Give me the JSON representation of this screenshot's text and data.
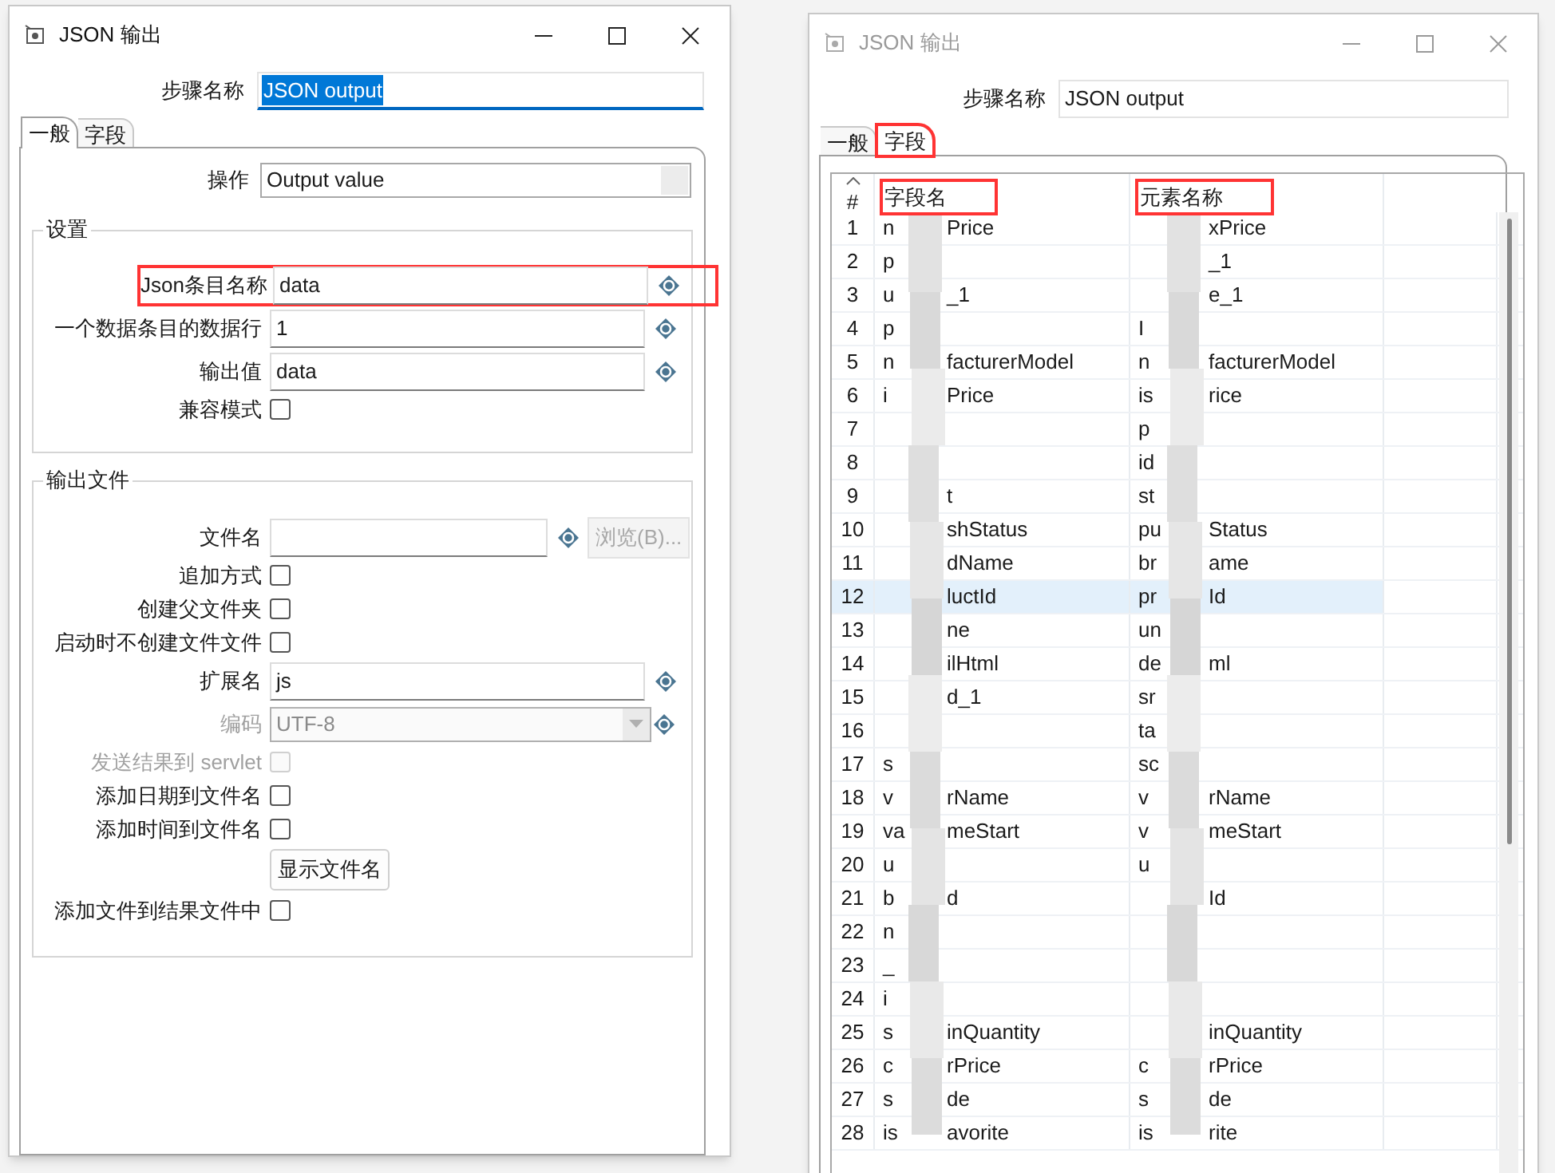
{
  "general_dialog": {
    "title": "JSON 输出",
    "active": true,
    "step_name": {
      "label": "步骤名称",
      "value": "JSON output",
      "text_selected": true
    },
    "tabs": [
      {
        "label": "一般",
        "selected": true
      },
      {
        "label": "字段",
        "selected": false
      }
    ],
    "operation": {
      "label": "操作",
      "value": "Output value"
    },
    "groups": [
      {
        "title": "设置",
        "rows": [
          {
            "kind": "text",
            "label": "Json条目名称",
            "value": "data",
            "variable": true,
            "annotated": true
          },
          {
            "kind": "text",
            "label": "一个数据条目的数据行",
            "value": "1",
            "variable": true
          },
          {
            "kind": "text",
            "label": "输出值",
            "value": "data",
            "variable": true
          },
          {
            "kind": "checkbox",
            "label": "兼容模式",
            "checked": false
          }
        ]
      },
      {
        "title": "输出文件",
        "rows": [
          {
            "kind": "text",
            "label": "文件名",
            "variable": true,
            "button": {
              "label": "浏览(B)...",
              "disabled": true
            }
          },
          {
            "kind": "checkbox",
            "label": "追加方式",
            "checked": false
          },
          {
            "kind": "checkbox",
            "label": "创建父文件夹",
            "checked": false
          },
          {
            "kind": "checkbox",
            "label": "启动时不创建文件文件",
            "checked": false
          },
          {
            "kind": "text",
            "label": "扩展名",
            "value": "js",
            "variable": true
          },
          {
            "kind": "combo",
            "label": "编码",
            "value": "UTF-8",
            "disabled": true,
            "variable": true
          },
          {
            "kind": "checkbox",
            "label": "发送结果到 servlet",
            "checked": false,
            "disabled": true
          },
          {
            "kind": "checkbox",
            "label": "添加日期到文件名",
            "checked": false
          },
          {
            "kind": "checkbox",
            "label": "添加时间到文件名",
            "checked": false
          },
          {
            "kind": "button",
            "label": "显示文件名"
          },
          {
            "kind": "checkbox",
            "label": "添加文件到结果文件中",
            "checked": false
          }
        ]
      }
    ]
  },
  "fields_dialog": {
    "title": "JSON 输出",
    "active": false,
    "step_name": {
      "label": "步骤名称",
      "value": "JSON output",
      "text_selected": false
    },
    "tabs": [
      {
        "label": "一般",
        "selected": false
      },
      {
        "label": "字段",
        "selected": true,
        "annotated": true
      }
    ],
    "table": {
      "columns": [
        {
          "label": "#"
        },
        {
          "label": "字段名",
          "annotated": true
        },
        {
          "label": "元素名称",
          "annotated": true
        }
      ],
      "rows": [
        {
          "number": "1",
          "field": {
            "start": "n",
            "end": "Price"
          },
          "element": {
            "end": "xPrice"
          },
          "selected": false
        },
        {
          "number": "2",
          "field": {
            "start": "p"
          },
          "element": {
            "end": "_1"
          },
          "selected": false
        },
        {
          "number": "3",
          "field": {
            "start": "u",
            "end": "_1"
          },
          "element": {
            "end": "e_1"
          },
          "selected": false
        },
        {
          "number": "4",
          "field": {
            "start": "p"
          },
          "element": {
            "start": "I"
          },
          "selected": false
        },
        {
          "number": "5",
          "field": {
            "start": "n",
            "end": "facturerModel"
          },
          "element": {
            "start": "n",
            "end": "facturerModel"
          },
          "selected": false
        },
        {
          "number": "6",
          "field": {
            "start": "i",
            "end": "Price"
          },
          "element": {
            "start": "is",
            "end": "rice"
          },
          "selected": false
        },
        {
          "number": "7",
          "field": {},
          "element": {
            "start": "p"
          },
          "selected": false
        },
        {
          "number": "8",
          "field": {},
          "element": {
            "start": "id"
          },
          "selected": false
        },
        {
          "number": "9",
          "field": {
            "end": "t"
          },
          "element": {
            "start": "st"
          },
          "selected": false
        },
        {
          "number": "10",
          "field": {
            "end": "shStatus"
          },
          "element": {
            "start": "pu",
            "end": "Status"
          },
          "selected": false
        },
        {
          "number": "11",
          "field": {
            "end": "dName"
          },
          "element": {
            "start": "br",
            "end": "ame"
          },
          "selected": false
        },
        {
          "number": "12",
          "field": {
            "end": "luctId"
          },
          "element": {
            "start": "pr",
            "end": "Id"
          },
          "selected": true
        },
        {
          "number": "13",
          "field": {
            "end": "ne"
          },
          "element": {
            "start": "un"
          },
          "selected": false
        },
        {
          "number": "14",
          "field": {
            "end": "ilHtml"
          },
          "element": {
            "start": "de",
            "end": "ml"
          },
          "selected": false
        },
        {
          "number": "15",
          "field": {
            "end": "d_1"
          },
          "element": {
            "start": "sr"
          },
          "selected": false
        },
        {
          "number": "16",
          "field": {},
          "element": {
            "start": "ta"
          },
          "selected": false
        },
        {
          "number": "17",
          "field": {
            "start": "s"
          },
          "element": {
            "start": "sc"
          },
          "selected": false
        },
        {
          "number": "18",
          "field": {
            "start": "v",
            "end": "rName"
          },
          "element": {
            "start": "v",
            "end": "rName"
          },
          "selected": false
        },
        {
          "number": "19",
          "field": {
            "start": "va",
            "end": "meStart"
          },
          "element": {
            "start": "v",
            "end": "meStart"
          },
          "selected": false
        },
        {
          "number": "20",
          "field": {
            "start": "u"
          },
          "element": {
            "start": "u"
          },
          "selected": false
        },
        {
          "number": "21",
          "field": {
            "start": "b",
            "end": "d"
          },
          "element": {
            "end": "Id"
          },
          "selected": false
        },
        {
          "number": "22",
          "field": {
            "start": "n"
          },
          "element": {},
          "selected": false
        },
        {
          "number": "23",
          "field": {
            "start": "_"
          },
          "element": {},
          "selected": false
        },
        {
          "number": "24",
          "field": {
            "start": "i"
          },
          "element": {},
          "selected": false
        },
        {
          "number": "25",
          "field": {
            "start": "s",
            "end": "inQuantity"
          },
          "element": {
            "end": "inQuantity"
          },
          "selected": false
        },
        {
          "number": "26",
          "field": {
            "start": "c",
            "end": "rPrice"
          },
          "element": {
            "start": "c",
            "end": "rPrice"
          },
          "selected": false
        },
        {
          "number": "27",
          "field": {
            "start": "s",
            "end": "de"
          },
          "element": {
            "start": "s",
            "end": "de"
          },
          "selected": false
        },
        {
          "number": "28",
          "field": {
            "start": "is",
            "end": "avorite"
          },
          "element": {
            "start": "is",
            "end": "rite"
          },
          "selected": false
        }
      ]
    }
  }
}
